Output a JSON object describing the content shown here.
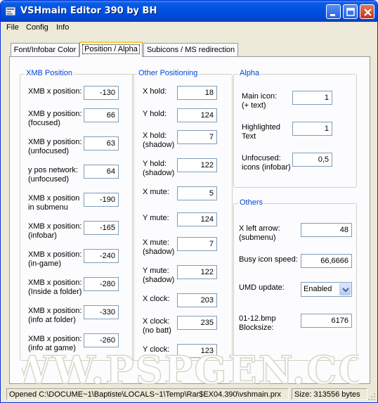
{
  "window": {
    "title": "VSHmain Editor 390 by BH"
  },
  "menu": [
    {
      "label": "File"
    },
    {
      "label": "Config"
    },
    {
      "label": "Info"
    }
  ],
  "tabs": [
    {
      "label": "Font/Infobar Color",
      "active": false
    },
    {
      "label": "Position / Alpha",
      "active": true
    },
    {
      "label": "Subicons / MS redirection",
      "active": false
    }
  ],
  "xmb_position": {
    "title": "XMB Position",
    "fields": [
      {
        "label": "XMB x position:",
        "value": "-130"
      },
      {
        "label": "XMB y position:\n(focused)",
        "value": "66"
      },
      {
        "label": "XMB y position:\n(unfocused)",
        "value": "63"
      },
      {
        "label": "y pos network:\n(unfocused)",
        "value": "64"
      },
      {
        "label": "XMB x position\nin submenu",
        "value": "-190"
      },
      {
        "label": "XMB x position:\n(infobar)",
        "value": "-165"
      },
      {
        "label": "XMB x position:\n(in-game)",
        "value": "-240"
      },
      {
        "label": "XMB x position:\n(Inside a folder)",
        "value": "-280"
      },
      {
        "label": "XMB x position:\n(info at folder)",
        "value": "-330"
      },
      {
        "label": "XMB x position:\n(info at game)",
        "value": "-260"
      }
    ]
  },
  "other_positioning": {
    "title": "Other Positioning",
    "fields": [
      {
        "label": "X hold:",
        "value": "18"
      },
      {
        "label": "Y hold:",
        "value": "124"
      },
      {
        "label": "X hold:\n(shadow)",
        "value": "7"
      },
      {
        "label": "Y hold:\n(shadow)",
        "value": "122"
      },
      {
        "label": "X mute:",
        "value": "5"
      },
      {
        "label": "Y mute:",
        "value": "124"
      },
      {
        "label": "X mute:\n(shadow)",
        "value": "7"
      },
      {
        "label": "Y mute:\n(shadow)",
        "value": "122"
      },
      {
        "label": "X clock:",
        "value": "203"
      },
      {
        "label": "X clock:\n(no batt)",
        "value": "235"
      },
      {
        "label": "Y clock:",
        "value": "123"
      }
    ]
  },
  "alpha": {
    "title": "Alpha",
    "fields": [
      {
        "label": "Main icon:\n(+ text)",
        "value": "1"
      },
      {
        "label": "Highlighted\nText",
        "value": "1"
      },
      {
        "label": "Unfocused:\nicons (infobar)",
        "value": "0,5"
      }
    ]
  },
  "others": {
    "title": "Others",
    "x_left_arrow": {
      "label": "X left arrow:\n(submenu)",
      "value": "48"
    },
    "busy_icon_speed": {
      "label": "Busy icon speed:",
      "value": "66,6666"
    },
    "umd_update": {
      "label": "UMD update:",
      "value": "Enabled"
    },
    "blocksize": {
      "label": "01-12.bmp\nBlocksize:",
      "value": "6176"
    }
  },
  "watermark": {
    "text": "WWW.PSPGEN.COM"
  },
  "status": {
    "path": "Opened C:\\DOCUME~1\\Baptiste\\LOCALS~1\\Temp\\Rar$EX04.390\\vshmain.prx",
    "size": "Size:  313556 bytes"
  },
  "colors": {
    "group_title": "#0046d5",
    "titlebar": "#0054e3",
    "window_bg": "#ece9d8"
  }
}
